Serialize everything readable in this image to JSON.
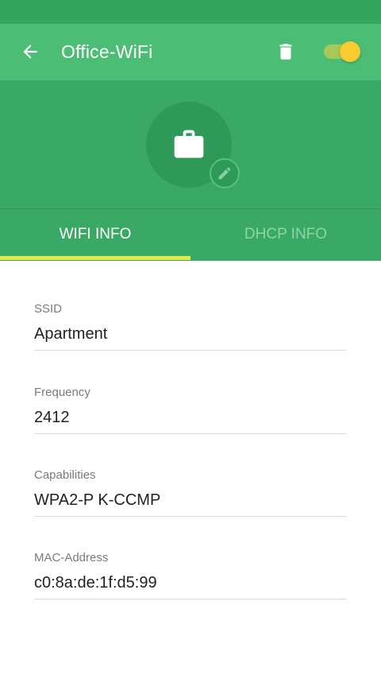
{
  "toolbar": {
    "title": "Office-WiFi",
    "back_icon": "arrow-left-icon",
    "delete_icon": "trash-icon",
    "toggle_state": "on"
  },
  "header": {
    "avatar_icon": "briefcase-icon",
    "edit_icon": "pencil-icon"
  },
  "tabs": [
    {
      "label": "WIFI INFO",
      "selected": true
    },
    {
      "label": "DHCP INFO",
      "selected": false
    }
  ],
  "fields": [
    {
      "label": "SSID",
      "value": "Apartment"
    },
    {
      "label": "Frequency",
      "value": "2412"
    },
    {
      "label": "Capabilities",
      "value": "WPA2-P K-CCMP"
    },
    {
      "label": "MAC-Address",
      "value": "c0:8a:de:1f:d5:99"
    }
  ],
  "colors": {
    "status_bar": "#34a55e",
    "toolbar": "#4cbd74",
    "header": "#3aa965",
    "tab_indicator": "#e8e84a",
    "toggle_thumb": "#f8cc2e"
  }
}
